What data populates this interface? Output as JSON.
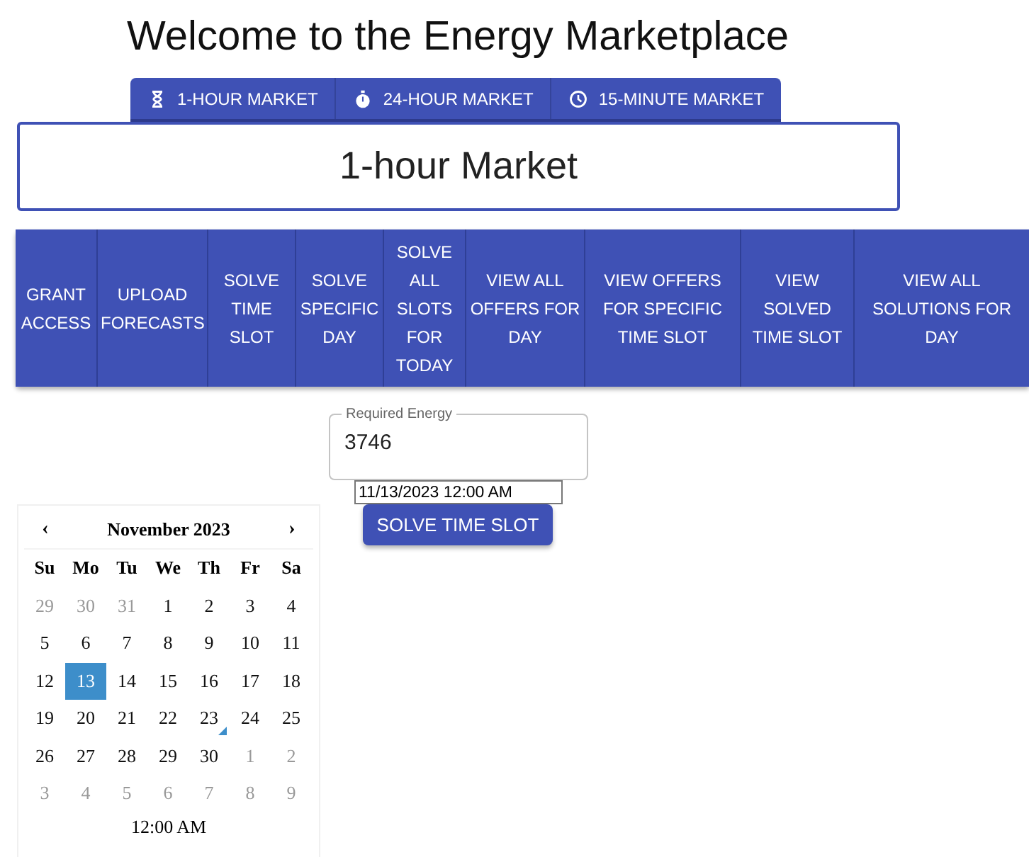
{
  "title": "Welcome to the Energy Marketplace",
  "market_tabs": [
    {
      "label": "1-HOUR MARKET"
    },
    {
      "label": "24-HOUR MARKET"
    },
    {
      "label": "15-MINUTE MARKET"
    }
  ],
  "market_heading": "1-hour Market",
  "actions": [
    {
      "label": "GRANT ACCESS"
    },
    {
      "label": "UPLOAD FORECASTS"
    },
    {
      "label": "SOLVE TIME SLOT"
    },
    {
      "label": "SOLVE SPECIFIC DAY"
    },
    {
      "label": "SOLVE ALL SLOTS FOR TODAY"
    },
    {
      "label": "VIEW ALL OFFERS FOR DAY"
    },
    {
      "label": "VIEW OFFERS FOR SPECIFIC TIME SLOT"
    },
    {
      "label": "VIEW SOLVED TIME SLOT"
    },
    {
      "label": "VIEW ALL SOLUTIONS FOR DAY"
    }
  ],
  "energy_field": {
    "label": "Required Energy",
    "value": "3746"
  },
  "datetime_field": {
    "value": "11/13/2023 12:00 AM"
  },
  "submit_button": "SOLVE TIME SLOT",
  "calendar": {
    "prev": "‹",
    "next": "›",
    "month": "November 2023",
    "weekdays": [
      "Su",
      "Mo",
      "Tu",
      "We",
      "Th",
      "Fr",
      "Sa"
    ],
    "days": [
      {
        "label": "29",
        "outside": true,
        "selected": false,
        "today": false
      },
      {
        "label": "30",
        "outside": true,
        "selected": false,
        "today": false
      },
      {
        "label": "31",
        "outside": true,
        "selected": false,
        "today": false
      },
      {
        "label": "1",
        "outside": false,
        "selected": false,
        "today": false
      },
      {
        "label": "2",
        "outside": false,
        "selected": false,
        "today": false
      },
      {
        "label": "3",
        "outside": false,
        "selected": false,
        "today": false
      },
      {
        "label": "4",
        "outside": false,
        "selected": false,
        "today": false
      },
      {
        "label": "5",
        "outside": false,
        "selected": false,
        "today": false
      },
      {
        "label": "6",
        "outside": false,
        "selected": false,
        "today": false
      },
      {
        "label": "7",
        "outside": false,
        "selected": false,
        "today": false
      },
      {
        "label": "8",
        "outside": false,
        "selected": false,
        "today": false
      },
      {
        "label": "9",
        "outside": false,
        "selected": false,
        "today": false
      },
      {
        "label": "10",
        "outside": false,
        "selected": false,
        "today": false
      },
      {
        "label": "11",
        "outside": false,
        "selected": false,
        "today": false
      },
      {
        "label": "12",
        "outside": false,
        "selected": false,
        "today": false
      },
      {
        "label": "13",
        "outside": false,
        "selected": true,
        "today": false
      },
      {
        "label": "14",
        "outside": false,
        "selected": false,
        "today": false
      },
      {
        "label": "15",
        "outside": false,
        "selected": false,
        "today": false
      },
      {
        "label": "16",
        "outside": false,
        "selected": false,
        "today": false
      },
      {
        "label": "17",
        "outside": false,
        "selected": false,
        "today": false
      },
      {
        "label": "18",
        "outside": false,
        "selected": false,
        "today": false
      },
      {
        "label": "19",
        "outside": false,
        "selected": false,
        "today": false
      },
      {
        "label": "20",
        "outside": false,
        "selected": false,
        "today": false
      },
      {
        "label": "21",
        "outside": false,
        "selected": false,
        "today": false
      },
      {
        "label": "22",
        "outside": false,
        "selected": false,
        "today": false
      },
      {
        "label": "23",
        "outside": false,
        "selected": false,
        "today": true
      },
      {
        "label": "24",
        "outside": false,
        "selected": false,
        "today": false
      },
      {
        "label": "25",
        "outside": false,
        "selected": false,
        "today": false
      },
      {
        "label": "26",
        "outside": false,
        "selected": false,
        "today": false
      },
      {
        "label": "27",
        "outside": false,
        "selected": false,
        "today": false
      },
      {
        "label": "28",
        "outside": false,
        "selected": false,
        "today": false
      },
      {
        "label": "29",
        "outside": false,
        "selected": false,
        "today": false
      },
      {
        "label": "30",
        "outside": false,
        "selected": false,
        "today": false
      },
      {
        "label": "1",
        "outside": true,
        "selected": false,
        "today": false
      },
      {
        "label": "2",
        "outside": true,
        "selected": false,
        "today": false
      },
      {
        "label": "3",
        "outside": true,
        "selected": false,
        "today": false
      },
      {
        "label": "4",
        "outside": true,
        "selected": false,
        "today": false
      },
      {
        "label": "5",
        "outside": true,
        "selected": false,
        "today": false
      },
      {
        "label": "6",
        "outside": true,
        "selected": false,
        "today": false
      },
      {
        "label": "7",
        "outside": true,
        "selected": false,
        "today": false
      },
      {
        "label": "8",
        "outside": true,
        "selected": false,
        "today": false
      },
      {
        "label": "9",
        "outside": true,
        "selected": false,
        "today": false
      }
    ],
    "time": "12:00 AM"
  }
}
